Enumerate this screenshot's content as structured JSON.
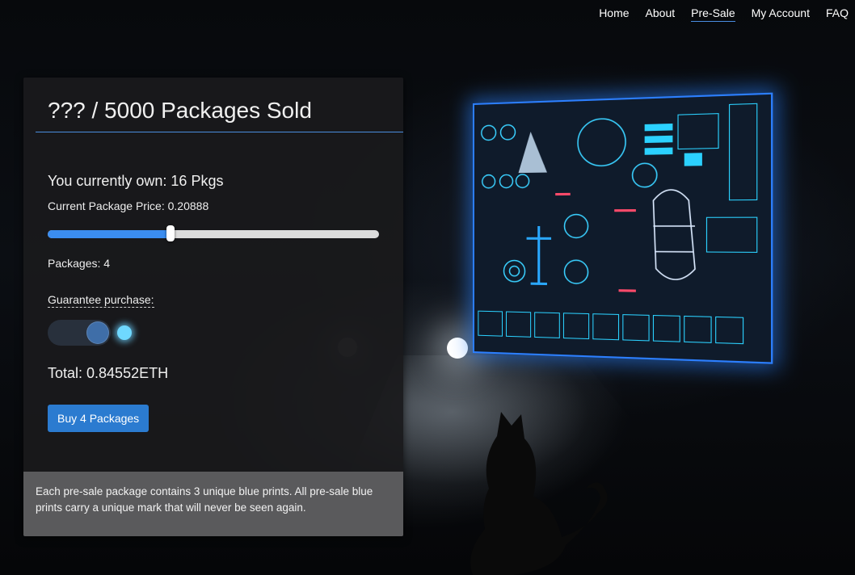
{
  "nav": {
    "items": [
      {
        "label": "Home"
      },
      {
        "label": "About"
      },
      {
        "label": "Pre-Sale",
        "active": true
      },
      {
        "label": "My Account"
      },
      {
        "label": "FAQ"
      }
    ]
  },
  "presale": {
    "title": "??? / 5000 Packages Sold",
    "owned_text": "You currently own: 16 Pkgs",
    "price_text": "Current Package Price: 0.20888",
    "slider_fraction": 0.37,
    "packages_text": "Packages: 4",
    "guarantee_label": "Guarantee purchase:",
    "guarantee_enabled": true,
    "total_text": "Total: 0.84552ETH",
    "buy_label": "Buy 4 Packages",
    "footer_text": "Each pre-sale package contains 3 unique blue prints. All pre-sale blue prints carry a unique mark that will never be seen again."
  },
  "colors": {
    "accent": "#3b8df0",
    "button": "#2b7bd0",
    "hud_glow": "#2c7fff",
    "toggle_led": "#6fd8ff"
  }
}
